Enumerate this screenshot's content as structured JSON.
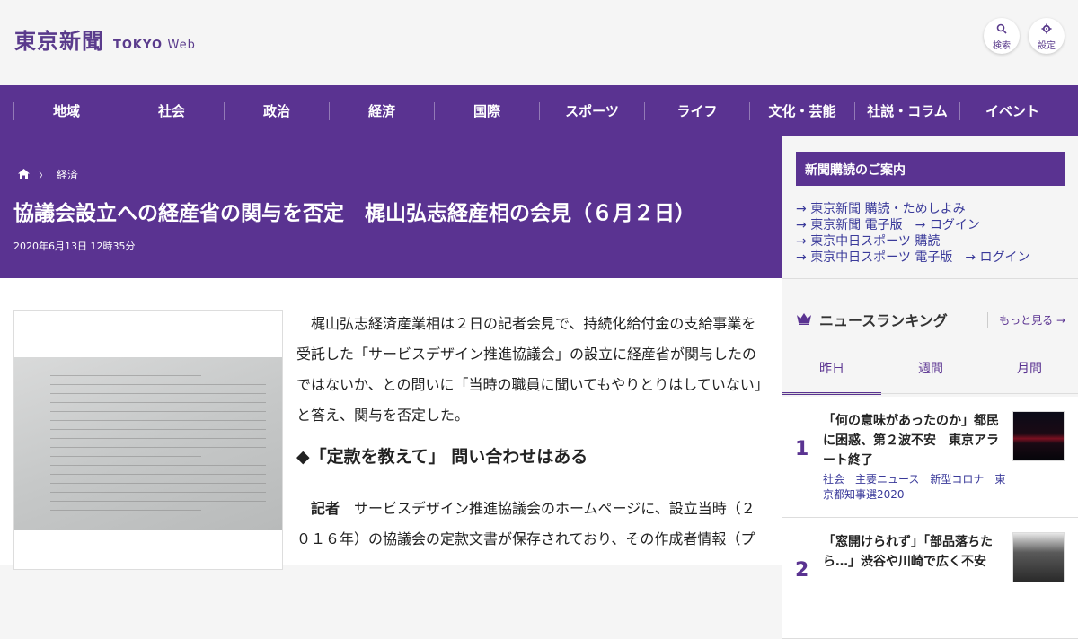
{
  "header": {
    "logo_kanji": "東京新聞",
    "logo_en_bold": "TOKYO",
    "logo_en_light": "Web",
    "search_label": "検索",
    "settings_label": "設定"
  },
  "nav": {
    "items": [
      "地域",
      "社会",
      "政治",
      "経済",
      "国際",
      "スポーツ",
      "ライフ",
      "文化・芸能",
      "社説・コラム",
      "イベント"
    ]
  },
  "article": {
    "breadcrumb_section": "経済",
    "title": "協議会設立への経産省の関与を否定　梶山弘志経産相の会見（６月２日）",
    "date": "2020年6月13日 12時35分",
    "paragraph1": "梶山弘志経済産業相は２日の記者会見で、持続化給付金の支給事業を受託した「サービスデザイン推進協議会」の設立に経産省が関与したのではないか、との問いに「当時の職員に聞いてもやりとりはしていない」と答え、関与を否定した。",
    "subhead": "◆「定款を教えて」 問い合わせはある",
    "q_speaker": "記者",
    "q_text": "　サービスデザイン推進協議会のホームページに、設立当時（２０１６年）の協議会の定款文書が保存されており、その作成者情報（プ"
  },
  "sidebar": {
    "subscribe_title": "新聞購読のご案内",
    "links": [
      [
        "東京新聞 購読・ためしよみ"
      ],
      [
        "東京新聞 電子版",
        "ログイン"
      ],
      [
        "東京中日スポーツ 購読"
      ],
      [
        "東京中日スポーツ 電子版",
        "ログイン"
      ]
    ],
    "ranking_title": "ニュースランキング",
    "more_label": "もっと見る",
    "tabs": [
      "昨日",
      "週間",
      "月間"
    ],
    "ranking": [
      {
        "rank": "1",
        "title": "「何の意味があったのか」都民に困惑、第２波不安　東京アラート終了",
        "tags": "社会　主要ニュース　新型コロナ　東京都知事選2020"
      },
      {
        "rank": "2",
        "title": "「窓開けられず」「部品落ちたら…」渋谷や川崎で広く不安",
        "tags": ""
      }
    ]
  },
  "colors": {
    "brand": "#5a3391",
    "link": "#3a3a9a"
  }
}
